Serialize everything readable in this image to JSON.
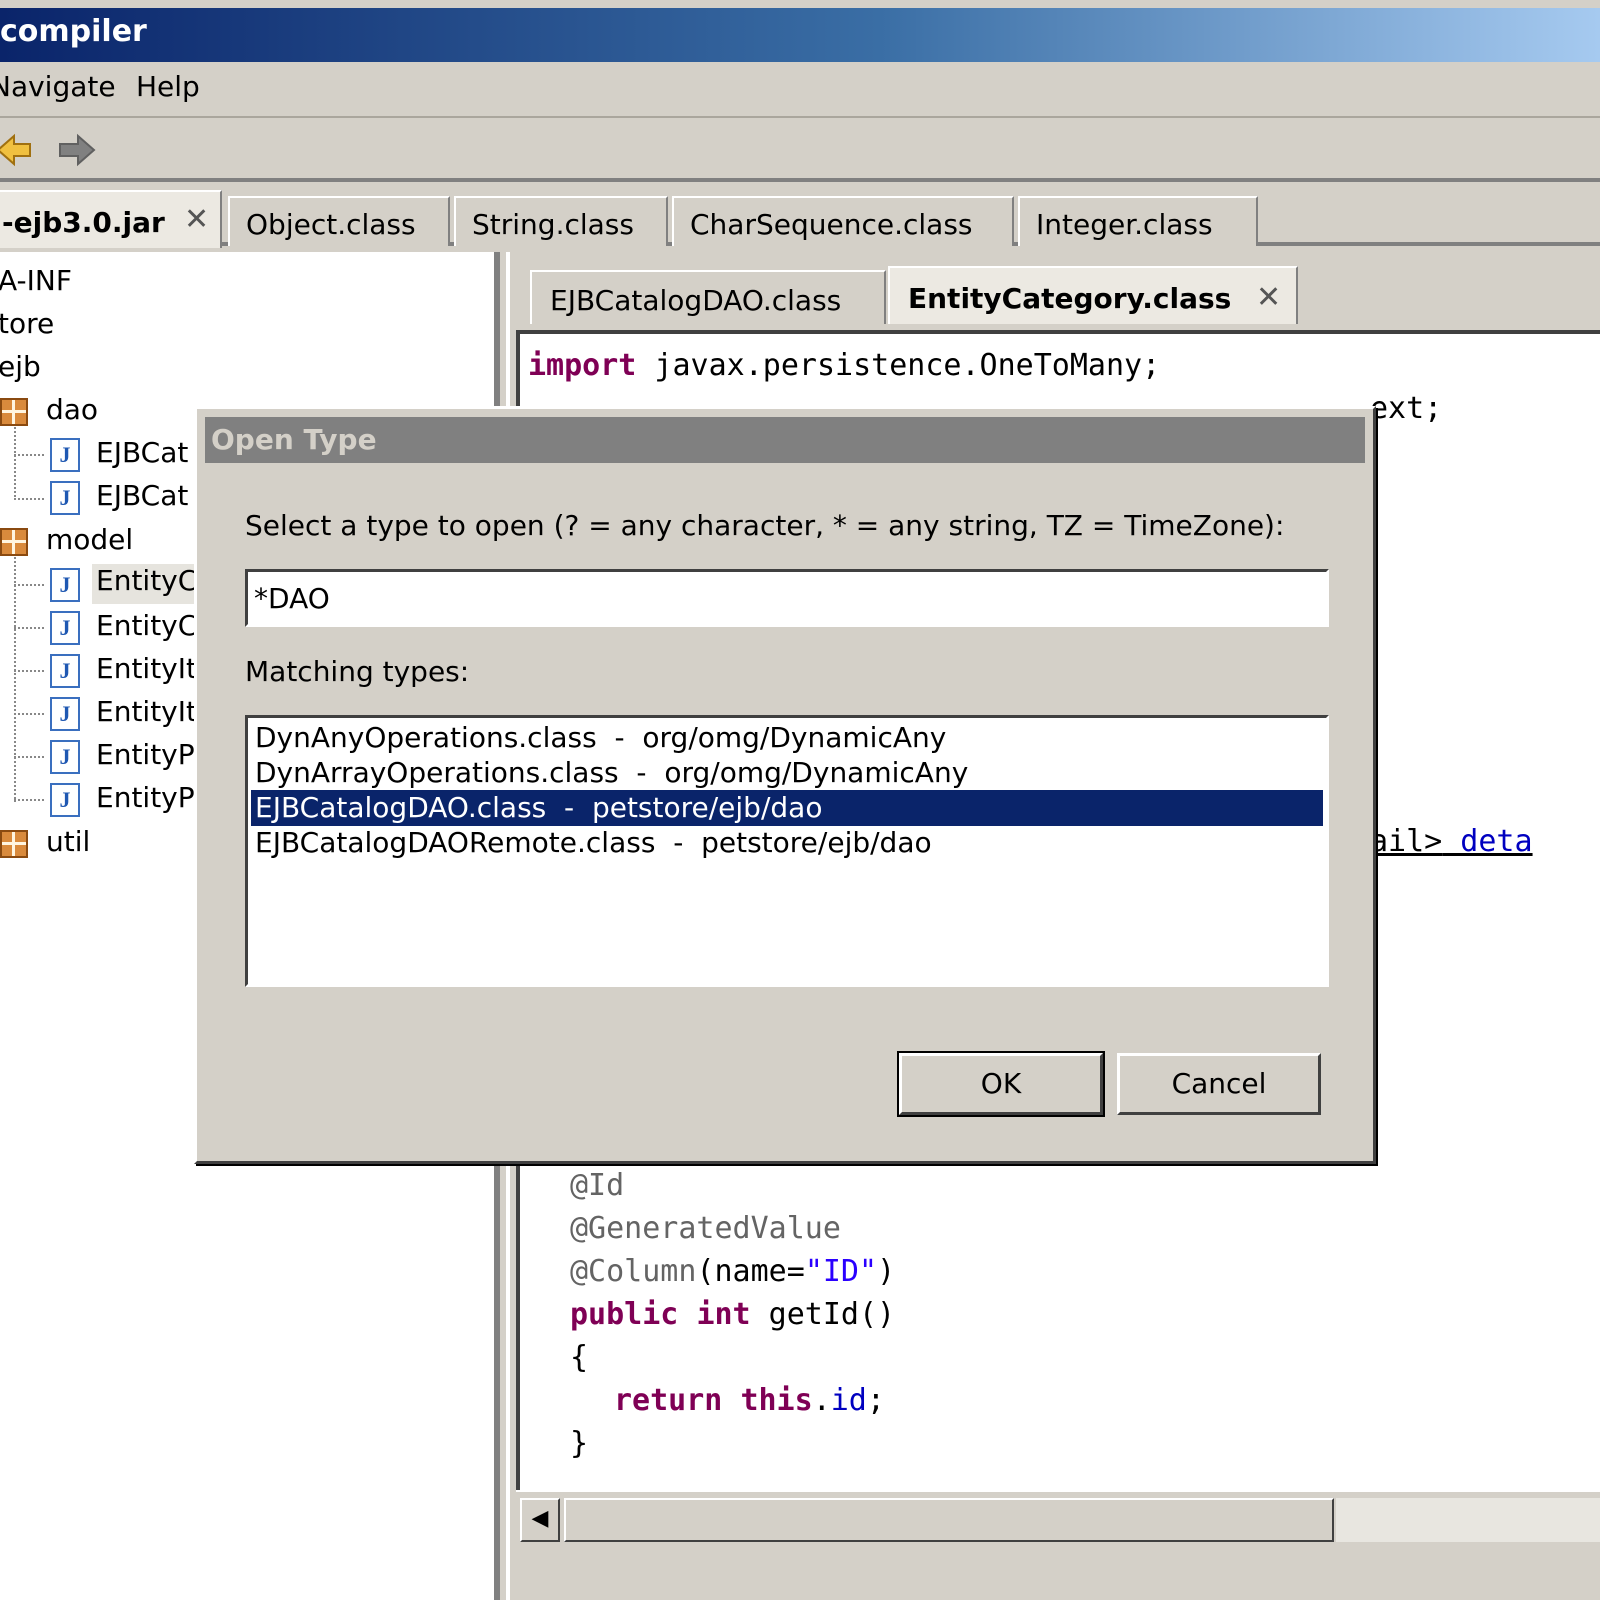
{
  "window": {
    "title": "compiler"
  },
  "menu": {
    "items": [
      "Navigate",
      "Help"
    ],
    "partial_first": "lavigate"
  },
  "toolbar": {
    "back_icon": "back-arrow-icon",
    "forward_icon": "forward-arrow-icon"
  },
  "top_tabs": [
    {
      "label": "-ejb3.0.jar",
      "active": true,
      "closable": true
    },
    {
      "label": "Object.class"
    },
    {
      "label": "String.class"
    },
    {
      "label": "CharSequence.class"
    },
    {
      "label": "Integer.class"
    }
  ],
  "tree": {
    "rows": [
      {
        "label": "A-INF",
        "type": "text"
      },
      {
        "label": "tore",
        "type": "text"
      },
      {
        "label": "ejb",
        "type": "text"
      },
      {
        "label": "dao",
        "type": "package"
      },
      {
        "label": "EJBCat",
        "type": "class"
      },
      {
        "label": "EJBCat",
        "type": "class"
      },
      {
        "label": "model",
        "type": "package"
      },
      {
        "label": "EntityC",
        "type": "class",
        "selected": true
      },
      {
        "label": "EntityC",
        "type": "class"
      },
      {
        "label": "EntityIt",
        "type": "class"
      },
      {
        "label": "EntityIt",
        "type": "class"
      },
      {
        "label": "EntityPr",
        "type": "class"
      },
      {
        "label": "EntityPr",
        "type": "class"
      },
      {
        "label": "util",
        "type": "package"
      }
    ]
  },
  "editor": {
    "tabs": [
      {
        "label": "EJBCatalogDAO.class"
      },
      {
        "label": "EntityCategory.class",
        "active": true,
        "closable": true
      }
    ],
    "code_top": {
      "line1_kw": "import",
      "line1_rest": " javax.persistence.OneToMany;",
      "line2_tail": "ext;"
    },
    "code_mid": {
      "frag1": "ail>",
      "frag2": " deta"
    },
    "code_bottom": {
      "ann1": "@Id",
      "ann2": "@GeneratedValue",
      "ann3": "@Column",
      "ann3_args_a": "(name=",
      "ann3_str": "\"ID\"",
      "ann3_args_b": ")",
      "sig_kw1": "public",
      "sig_kw2": "int",
      "sig_rest": " getId()",
      "open_brace": "{",
      "ret_kw1": "return",
      "ret_kw2": "this",
      "ret_dot": ".",
      "ret_field": "id",
      "ret_semi": ";",
      "close_brace": "}"
    }
  },
  "dialog": {
    "title": "Open Type",
    "prompt": "Select a type to open (? = any character, * = any string, TZ = TimeZone):",
    "input_value": "*DAO",
    "matching_label": "Matching types:",
    "results": [
      {
        "label": "DynAnyOperations.class  -  org/omg/DynamicAny"
      },
      {
        "label": "DynArrayOperations.class  -  org/omg/DynamicAny"
      },
      {
        "label": "EJBCatalogDAO.class  -  petstore/ejb/dao",
        "selected": true
      },
      {
        "label": "EJBCatalogDAORemote.class  -  petstore/ejb/dao"
      }
    ],
    "ok_label": "OK",
    "cancel_label": "Cancel"
  }
}
